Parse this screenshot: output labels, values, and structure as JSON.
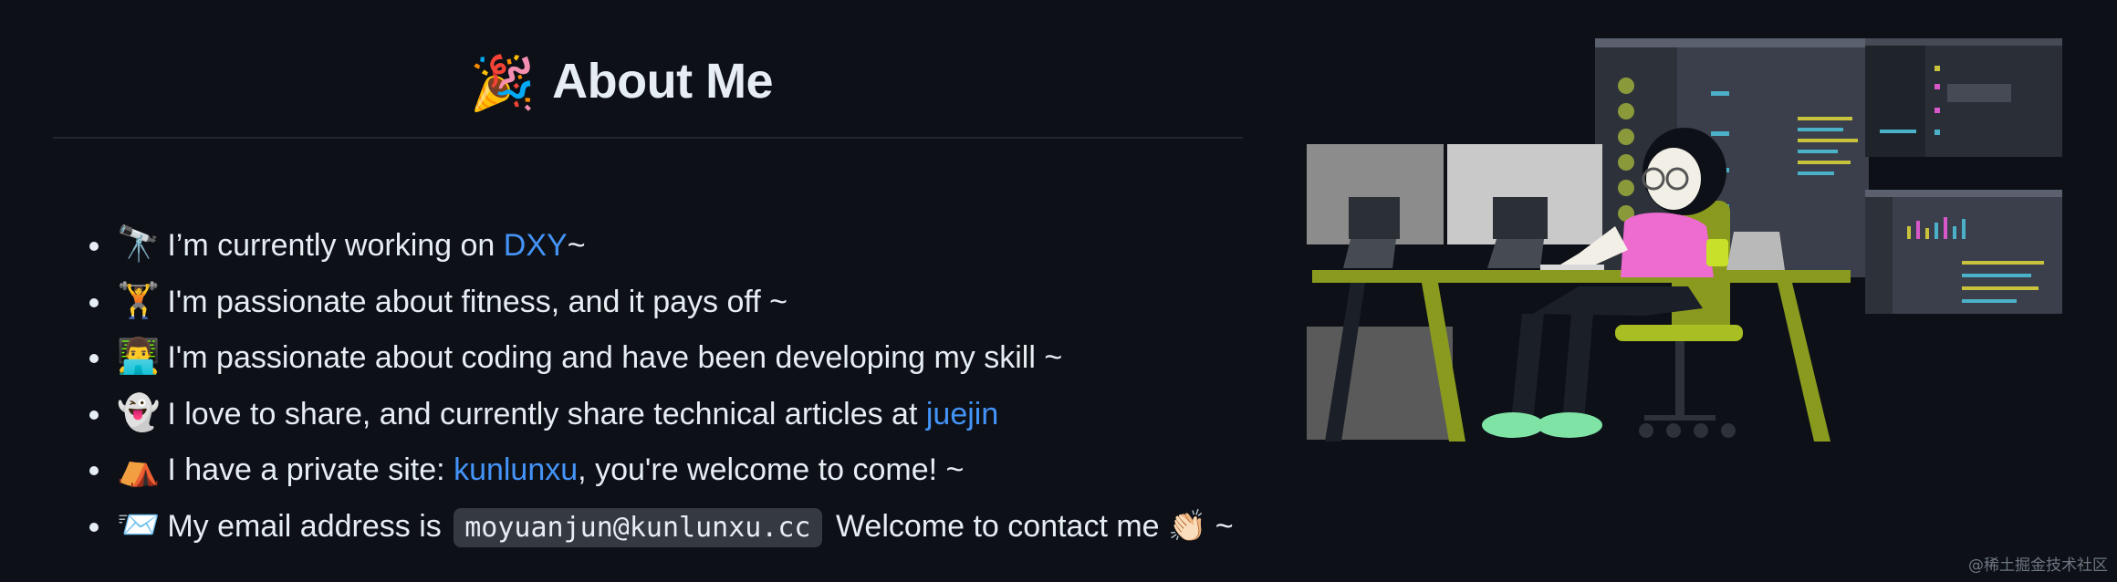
{
  "heading": {
    "emoji": "🎉",
    "title": "About Me"
  },
  "items": [
    {
      "emoji": "🔭",
      "pre": "I’m currently working on ",
      "link": "DXY",
      "post": "~"
    },
    {
      "emoji": "🏋️",
      "text": "I'm passionate about fitness, and it pays off ~"
    },
    {
      "emoji": "👨‍💻",
      "text": "I'm passionate about coding and have been developing my skill ~"
    },
    {
      "emoji": "👻",
      "pre": "I love to share, and currently share technical articles at ",
      "link": "juejin",
      "post": ""
    },
    {
      "emoji": "⛺",
      "pre": "I have a private site: ",
      "link": "kunlunxu",
      "post": ", you're welcome to come! ~"
    },
    {
      "emoji": "📨",
      "pre": "My email address is",
      "code": "moyuanjun@kunlunxu.cc",
      "post": "Welcome to contact me 👏🏻 ~"
    }
  ],
  "watermark": "@稀土掘金技术社区",
  "colors": {
    "background": "#0d1117",
    "link": "#4493f8",
    "text": "#e6edf3",
    "accent_olive": "#8a9a1e"
  }
}
